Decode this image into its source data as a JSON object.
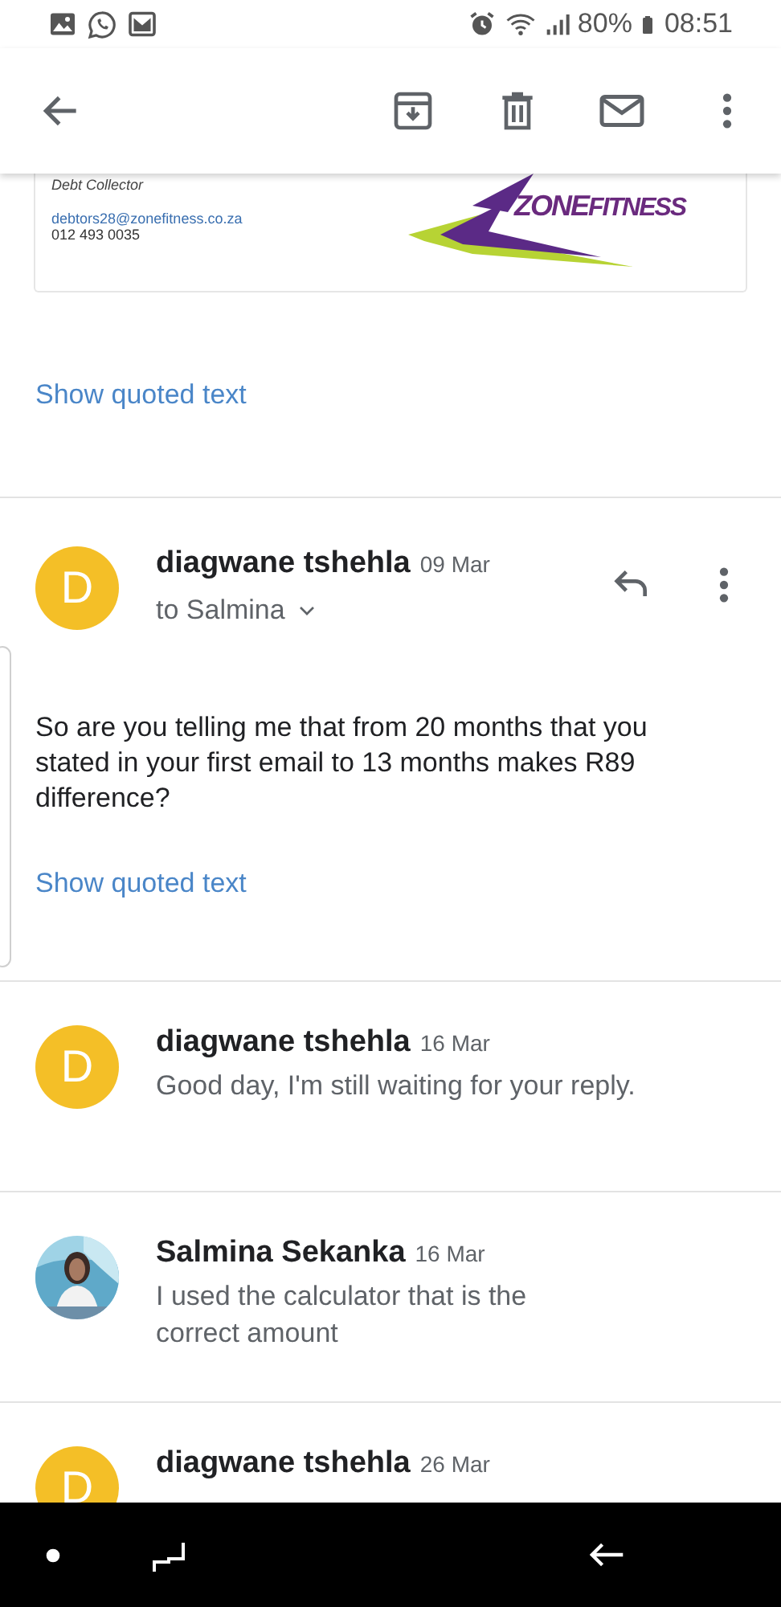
{
  "status_bar": {
    "battery": "80%",
    "time": "08:51"
  },
  "signature": {
    "title": "Debt Collector",
    "email": "debtors28@zonefitness.co.za",
    "phone": "012 493 0035",
    "logo": {
      "word_1": "ZONE",
      "word_2": "FITNESS"
    }
  },
  "show_quoted_text": "Show quoted text",
  "expanded_message": {
    "avatar_letter": "D",
    "sender": "diagwane tshehla",
    "date": "09 Mar",
    "recipient": "to Salmina",
    "body": "So are you telling me that from 20 months that you stated in your first email to 13 months makes R89 difference?",
    "show_quoted_text": "Show quoted text"
  },
  "messages": [
    {
      "kind": "letter",
      "avatar_letter": "D",
      "sender": "diagwane tshehla",
      "date": "16 Mar",
      "preview": "Good day, I'm still waiting for your reply."
    },
    {
      "sender": "Salmina Sekanka",
      "date": "16 Mar",
      "preview": "I used the calculator that is the\ncorrect amount"
    },
    {
      "kind": "letter",
      "avatar_letter": "D",
      "sender": "diagwane tshehla",
      "date": "26 Mar"
    }
  ]
}
